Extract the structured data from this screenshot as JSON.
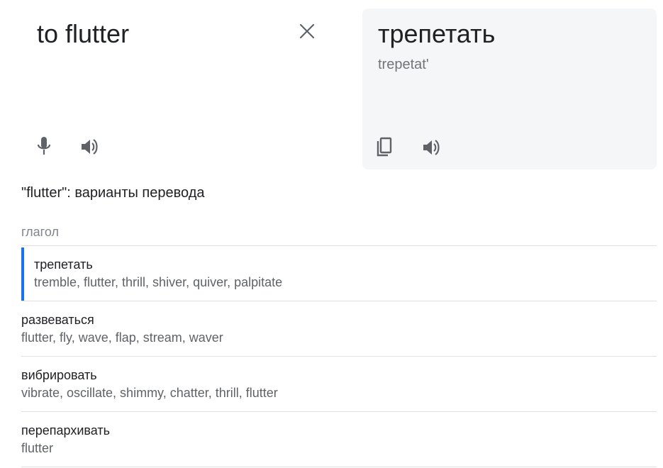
{
  "source": {
    "text": "to flutter",
    "icons": {
      "clear": "close-icon",
      "mic": "mic-icon",
      "speaker": "speaker-icon"
    }
  },
  "target": {
    "text": "трепетать",
    "transliteration": "trepetat'",
    "icons": {
      "copy": "copy-icon",
      "speaker": "speaker-icon"
    }
  },
  "variants": {
    "heading": "\"flutter\": варианты перевода",
    "part_of_speech": "глагол",
    "items": [
      {
        "word": "трепетать",
        "synonyms": "tremble, flutter, thrill, shiver, quiver, palpitate",
        "selected": true
      },
      {
        "word": "развеваться",
        "synonyms": "flutter, fly, wave, flap, stream, waver",
        "selected": false
      },
      {
        "word": "вибрировать",
        "synonyms": "vibrate, oscillate, shimmy, chatter, thrill, flutter",
        "selected": false
      },
      {
        "word": "перепархивать",
        "synonyms": "flutter",
        "selected": false
      }
    ]
  },
  "colors": {
    "accent": "#1a73e8",
    "target_panel_bg": "#f5f6f8",
    "icon": "#5f6368"
  }
}
